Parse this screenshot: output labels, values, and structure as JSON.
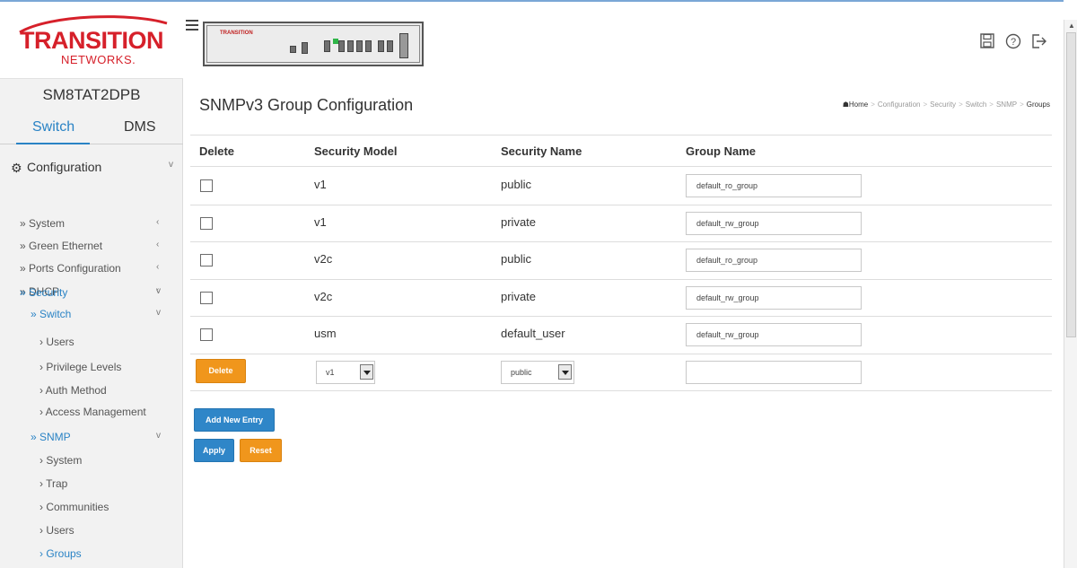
{
  "brand": {
    "logo_main": "TRANSITION",
    "logo_sub": "NETWORKS.",
    "device_logo": "TRANSITION"
  },
  "sidebar": {
    "model": "SM8TAT2DPB",
    "tabs": [
      "Switch",
      "DMS"
    ],
    "nav": [
      {
        "label": "Configuration",
        "indent": 0,
        "head": true,
        "active": false,
        "chev": "v"
      },
      {
        "label": "» System",
        "indent": 1,
        "head": false,
        "active": false,
        "chev": "‹"
      },
      {
        "label": "» Green Ethernet",
        "indent": 1,
        "head": false,
        "active": false,
        "chev": "‹"
      },
      {
        "label": "» Ports Configuration",
        "indent": 1,
        "head": false,
        "active": false,
        "chev": "‹"
      },
      {
        "label": "» DHCP",
        "indent": 1,
        "head": false,
        "active": false,
        "chev": "‹"
      },
      {
        "label": "» Security",
        "indent": 1,
        "head": false,
        "active": true,
        "chev": "v"
      },
      {
        "label": "» Switch",
        "indent": 2,
        "head": false,
        "active": true,
        "chev": "v"
      },
      {
        "label": "› Users",
        "indent": 3,
        "head": false,
        "active": false,
        "chev": ""
      },
      {
        "label": "› Privilege Levels",
        "indent": 3,
        "head": false,
        "active": false,
        "chev": ""
      },
      {
        "label": "› Auth Method",
        "indent": 3,
        "head": false,
        "active": false,
        "chev": ""
      },
      {
        "label": "› Access Management",
        "indent": 3,
        "head": false,
        "active": false,
        "chev": ""
      },
      {
        "label": "» SNMP",
        "indent": 2,
        "head": false,
        "active": true,
        "chev": "v"
      },
      {
        "label": "› System",
        "indent": 3,
        "head": false,
        "active": false,
        "chev": ""
      },
      {
        "label": "› Trap",
        "indent": 3,
        "head": false,
        "active": false,
        "chev": ""
      },
      {
        "label": "› Communities",
        "indent": 3,
        "head": false,
        "active": false,
        "chev": ""
      },
      {
        "label": "› Users",
        "indent": 3,
        "head": false,
        "active": false,
        "chev": ""
      },
      {
        "label": "› Groups",
        "indent": 3,
        "head": false,
        "active": true,
        "chev": ""
      }
    ]
  },
  "header": {
    "icons": [
      "save-icon",
      "help-icon",
      "logout-icon"
    ]
  },
  "page": {
    "title": "SNMPv3 Group Configuration",
    "breadcrumb": [
      "Home",
      "Configuration",
      "Security",
      "Switch",
      "SNMP",
      "Groups"
    ]
  },
  "table": {
    "headers": [
      "Delete",
      "Security Model",
      "Security Name",
      "Group Name"
    ],
    "rows": [
      {
        "model": "v1",
        "name": "public",
        "group": "default_ro_group"
      },
      {
        "model": "v1",
        "name": "private",
        "group": "default_rw_group"
      },
      {
        "model": "v2c",
        "name": "public",
        "group": "default_ro_group"
      },
      {
        "model": "v2c",
        "name": "private",
        "group": "default_rw_group"
      },
      {
        "model": "usm",
        "name": "default_user",
        "group": "default_rw_group"
      }
    ],
    "new_row": {
      "delete_label": "Delete",
      "model_selected": "v1",
      "name_selected": "public",
      "group_value": ""
    }
  },
  "buttons": {
    "add_new_entry": "Add New Entry",
    "apply": "Apply",
    "reset": "Reset"
  },
  "colors": {
    "accent_blue": "#2f86c8",
    "accent_orange": "#f0961c",
    "brand_red": "#d6202a"
  }
}
